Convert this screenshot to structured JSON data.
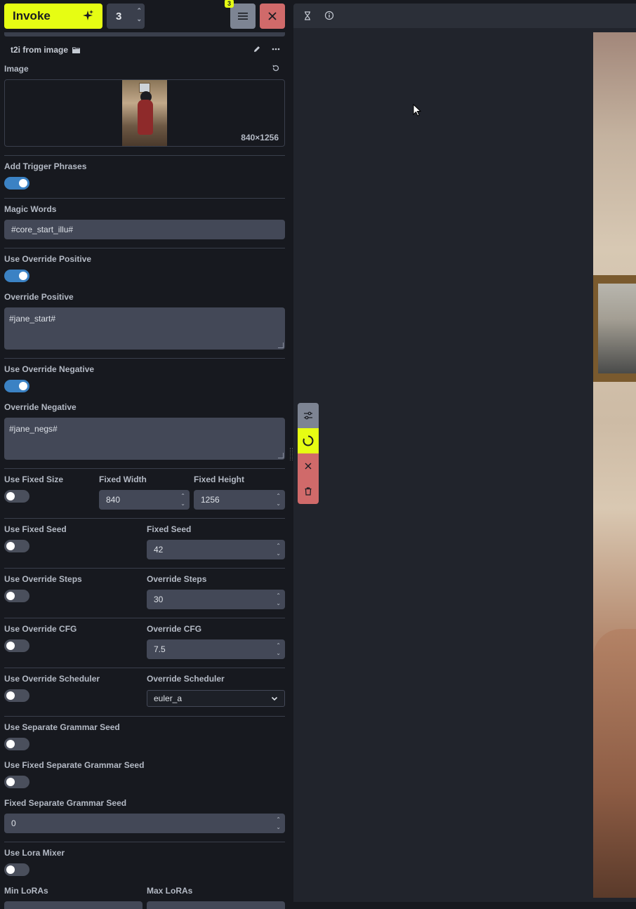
{
  "topbar": {
    "invoke_label": "Invoke",
    "iterations_value": "3",
    "queue_badge": "3"
  },
  "workflow": {
    "title": "t2i from image"
  },
  "image_field": {
    "label": "Image",
    "dimensions": "840×1256"
  },
  "fields": {
    "add_trigger_phrases": {
      "label": "Add Trigger Phrases",
      "enabled": true
    },
    "magic_words": {
      "label": "Magic Words",
      "value": "#core_start_illu#"
    },
    "use_override_positive": {
      "label": "Use Override Positive",
      "enabled": true
    },
    "override_positive": {
      "label": "Override Positive",
      "value": "#jane_start#"
    },
    "use_override_negative": {
      "label": "Use Override Negative",
      "enabled": true
    },
    "override_negative": {
      "label": "Override Negative",
      "value": "#jane_negs#"
    },
    "use_fixed_size": {
      "label": "Use Fixed Size",
      "enabled": false
    },
    "fixed_width": {
      "label": "Fixed Width",
      "value": "840"
    },
    "fixed_height": {
      "label": "Fixed Height",
      "value": "1256"
    },
    "use_fixed_seed": {
      "label": "Use Fixed Seed",
      "enabled": false
    },
    "fixed_seed": {
      "label": "Fixed Seed",
      "value": "42"
    },
    "use_override_steps": {
      "label": "Use Override Steps",
      "enabled": false
    },
    "override_steps": {
      "label": "Override Steps",
      "value": "30"
    },
    "use_override_cfg": {
      "label": "Use Override CFG",
      "enabled": false
    },
    "override_cfg": {
      "label": "Override CFG",
      "value": "7.5"
    },
    "use_override_scheduler": {
      "label": "Use Override Scheduler",
      "enabled": false
    },
    "override_scheduler": {
      "label": "Override Scheduler",
      "value": "euler_a"
    },
    "use_separate_grammar_seed": {
      "label": "Use Separate Grammar Seed",
      "enabled": false
    },
    "use_fixed_separate_grammar_seed": {
      "label": "Use Fixed Separate Grammar Seed",
      "enabled": false
    },
    "fixed_separate_grammar_seed": {
      "label": "Fixed Separate Grammar Seed",
      "value": "0"
    },
    "use_lora_mixer": {
      "label": "Use Lora Mixer",
      "enabled": false
    },
    "min_loras": {
      "label": "Min LoRAs"
    },
    "max_loras": {
      "label": "Max LoRAs"
    }
  },
  "colors": {
    "accent_yellow": "#e6fd13",
    "toggle_on": "#3b82c4",
    "danger": "#d06a6a"
  },
  "icons": {
    "invoke": "sparkles-icon",
    "menu": "hamburger-icon",
    "close": "close-icon",
    "folder": "folder-icon",
    "edit": "pencil-icon",
    "more": "ellipsis-icon",
    "reset": "reset-icon",
    "queue": "hourglass-icon",
    "info": "info-icon",
    "settings": "sliders-icon",
    "progress": "spinner-icon",
    "cancel": "x-icon",
    "delete": "trash-icon"
  }
}
